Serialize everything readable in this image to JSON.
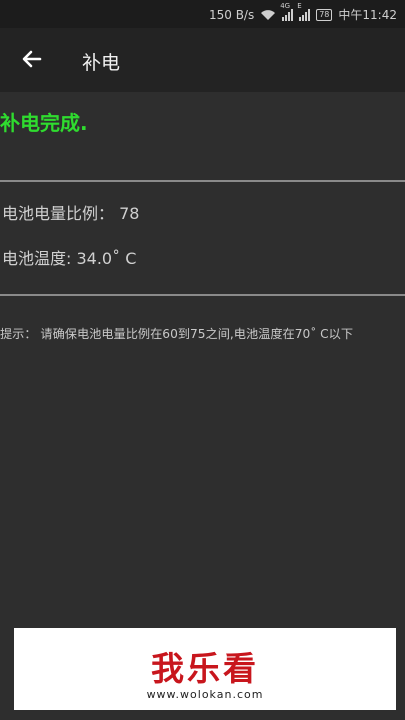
{
  "status_bar": {
    "speed": "150 B/s",
    "net_4g": "4G",
    "net_e": "E",
    "battery": "78",
    "time": "中午11:42"
  },
  "app_bar": {
    "title": "补电",
    "back_icon": "arrow-left-icon"
  },
  "content": {
    "status": "补电完成.",
    "battery_level": "电池电量比例： 78",
    "battery_temp": "电池温度: 34.0˚ C",
    "tip": "提示：  请确保电池电量比例在60到75之间,电池温度在70˚ C以下"
  },
  "ad": {
    "brand": "我乐看",
    "site": "www.wolokan.com"
  },
  "colors": {
    "background": "#2e2e2e",
    "appbar": "#232323",
    "success": "#2fdc2f"
  }
}
